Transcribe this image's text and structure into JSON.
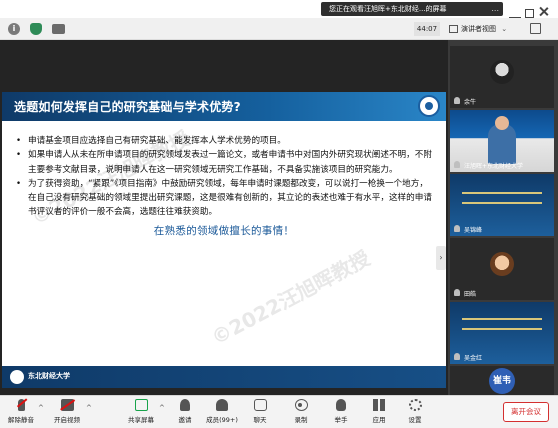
{
  "banner": {
    "text": "您正在观看汪旭晖+东北财经...的屏幕",
    "more": "..."
  },
  "statusbar": {
    "timer": "44:07",
    "view_label": "演讲者视图"
  },
  "slide": {
    "title": "选题如何发挥自己的研究基础与学术优势?",
    "bullets": [
      "申请基金项目应选择自己有研究基础、能发挥本人学术优势的项目。",
      "如果申请人从未在所申请项目的研究领域发表过一篇论文，或者申请书中对国内外研究现状阐述不明，不附主要参考文献目录，说明申请人在这一研究领域无研究工作基础，不具备实施该项目的研究能力。",
      "为了获得资助，“紧跟”《项目指南》中鼓励研究领域，每年申请时课题都改变，可以说打一枪换一个地方，在自己没有研究基础的领域里提出研究课题，这是很难有创新的，其立论的表述也难于有水平，这样的申请书评议者的评价一般不会高，选题往往难获资助。"
    ],
    "highlight": "在熟悉的领域做擅长的事情！",
    "watermark": "©2022汪旭晖教授",
    "footer": "东北财经大学"
  },
  "participants": [
    {
      "name": "余牛"
    },
    {
      "name": "汪旭晖+东北财经大学"
    },
    {
      "name": "吴锦峰"
    },
    {
      "name": "田皓"
    },
    {
      "name": "吴金红"
    },
    {
      "name": "崔韦",
      "badge": "崔韦"
    }
  ],
  "toolbar": {
    "mute": "解除静音",
    "video": "开启视频",
    "share": "共享屏幕",
    "invite": "邀请",
    "members": "成员(99+)",
    "chat": "聊天",
    "record": "录制",
    "raise_hand": "举手",
    "apps": "应用",
    "settings": "设置",
    "leave": "离开会议"
  },
  "colors": {
    "accent": "#1c5a99",
    "leave": "#d43030",
    "share": "#17a34a"
  }
}
